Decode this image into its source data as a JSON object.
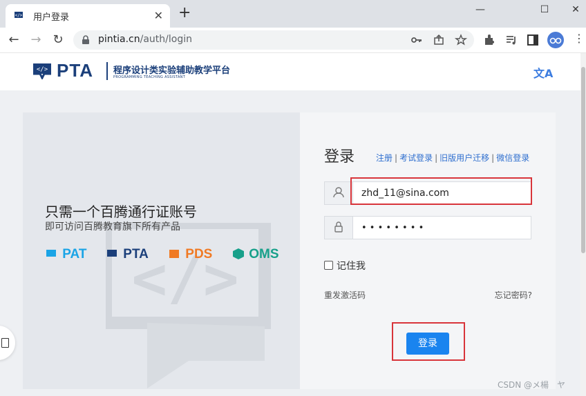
{
  "browser": {
    "tab_title": "用户登录",
    "close_glyph": "✕",
    "new_tab_glyph": "+",
    "url_host": "pintia.cn",
    "url_path": "/auth/login",
    "window_minimize": "—",
    "window_restore": "☐",
    "window_close": "✕"
  },
  "site": {
    "logo_text": "PTA",
    "logo_cn": "程序设计类实验辅助教学平台",
    "logo_en": "PROGRAMMING TEACHING ASSISTANT",
    "lang_icon": "文A"
  },
  "promo": {
    "headline": "只需一个百腾通行证账号",
    "subline": "即可访问百腾教育旗下所有产品",
    "brands": [
      {
        "name": "PAT",
        "color": "#1aa4e6"
      },
      {
        "name": "PTA",
        "color": "#1b3f7a"
      },
      {
        "name": "PDS",
        "color": "#f07a24"
      },
      {
        "name": "OMS",
        "color": "#17a08a"
      }
    ]
  },
  "login": {
    "title": "登录",
    "links": [
      "注册",
      "考试登录",
      "旧版用户迁移",
      "微信登录"
    ],
    "username_value": "zhd_11@sina.com",
    "password_mask": "• • • • • • • •",
    "remember_label": "记住我",
    "remember_checked": false,
    "resend_label": "重发激活码",
    "forgot_label": "忘记密码?",
    "submit_label": "登录"
  },
  "footer": {
    "watermark": "CSDN @メ楊　ヤ"
  },
  "colors": {
    "accent": "#1a84ef",
    "highlight": "#d8343a",
    "link": "#2f6fcf"
  }
}
